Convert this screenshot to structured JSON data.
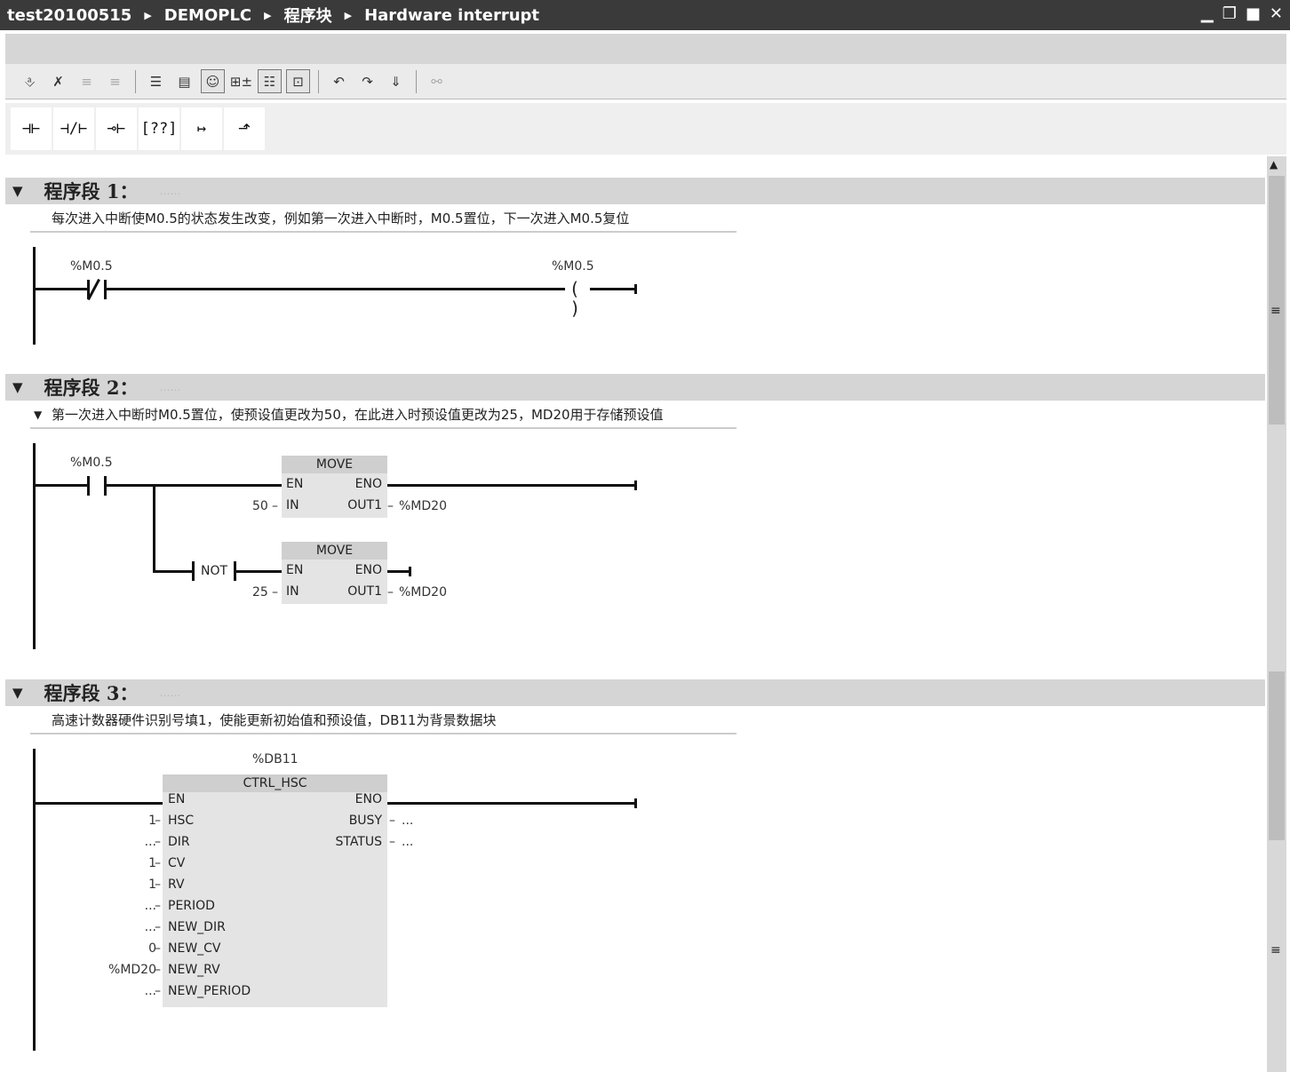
{
  "breadcrumb": [
    "test20100515",
    "DEMOPLC",
    "程序块",
    "Hardware interrupt"
  ],
  "window_controls": {
    "minimize": "▁",
    "restore": "❐",
    "maximize": "■",
    "close": "✕"
  },
  "toolbar_icons": [
    "insert-network",
    "delete-network",
    "insert-row",
    "add-row",
    "open-all-networks",
    "close-all-networks",
    "show-comments",
    "favorites",
    "absolute-address",
    "operand-view",
    "previous-error",
    "next-error",
    "update-call",
    "monitor-off"
  ],
  "instructions": [
    "⊣⊢",
    "⊣/⊢",
    "⊸⊢",
    "[??]",
    "↦",
    "⬏"
  ],
  "networks": [
    {
      "title": "程序段 1：",
      "comment": "每次进入中断使M0.5的状态发生改变，例如第一次进入中断时，M0.5置位，下一次进入M0.5复位",
      "contact_operand": "%M0.5",
      "coil_operand": "%M0.5",
      "coil_symbol": "( )"
    },
    {
      "title": "程序段 2：",
      "comment": "第一次进入中断时M0.5置位，使预设值更改为50，在此进入时预设值更改为25，MD20用于存储预设值",
      "contact_operand": "%M0.5",
      "not_label": "NOT",
      "move1": {
        "title": "MOVE",
        "en": "EN",
        "eno": "ENO",
        "in": "IN",
        "out": "OUT1",
        "in_value": "50",
        "out_value": "%MD20"
      },
      "move2": {
        "title": "MOVE",
        "en": "EN",
        "eno": "ENO",
        "in": "IN",
        "out": "OUT1",
        "in_value": "25",
        "out_value": "%MD20"
      }
    },
    {
      "title": "程序段 3：",
      "comment": "高速计数器硬件识别号填1，使能更新初始值和预设值，DB11为背景数据块",
      "instance_db": "%DB11",
      "block_title": "CTRL_HSC",
      "inputs": [
        {
          "name": "EN",
          "value": ""
        },
        {
          "name": "HSC",
          "value": "1"
        },
        {
          "name": "DIR",
          "value": "..."
        },
        {
          "name": "CV",
          "value": "1"
        },
        {
          "name": "RV",
          "value": "1"
        },
        {
          "name": "PERIOD",
          "value": "..."
        },
        {
          "name": "NEW_DIR",
          "value": "..."
        },
        {
          "name": "NEW_CV",
          "value": "0"
        },
        {
          "name": "NEW_RV",
          "value": "%MD20"
        },
        {
          "name": "NEW_PERIOD",
          "value": "..."
        }
      ],
      "outputs": [
        {
          "name": "ENO",
          "value": ""
        },
        {
          "name": "BUSY",
          "value": "..."
        },
        {
          "name": "STATUS",
          "value": "..."
        }
      ]
    }
  ],
  "net_dots": "……"
}
